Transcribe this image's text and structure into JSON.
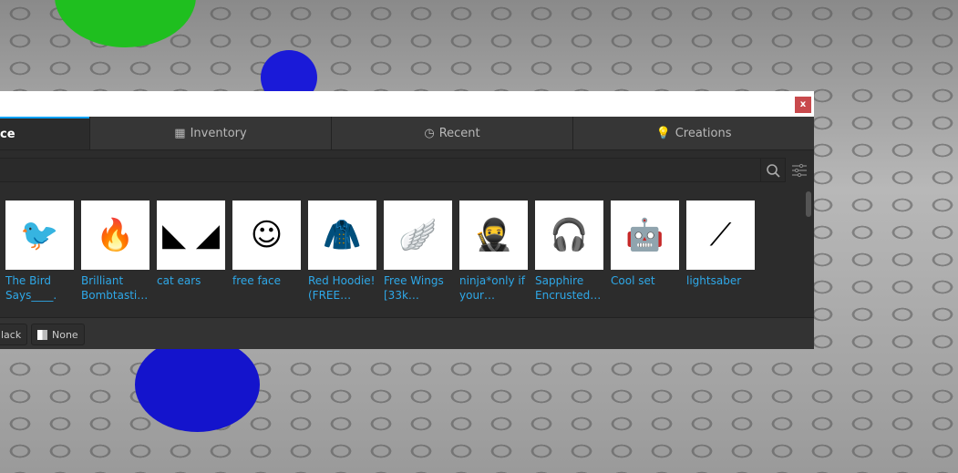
{
  "tabs": [
    {
      "label": "ce",
      "icon": "marketplace-icon"
    },
    {
      "label": "Inventory",
      "icon": "inventory-grid-icon"
    },
    {
      "label": "Recent",
      "icon": "clock-icon"
    },
    {
      "label": "Creations",
      "icon": "lightbulb-icon"
    }
  ],
  "close_label": "x",
  "items": [
    {
      "name": "The Bird\nSays____.",
      "glyph": "🐦"
    },
    {
      "name": "Brilliant\nBombtasti…",
      "glyph": "🔥"
    },
    {
      "name": "cat ears",
      "glyph": "◣ ◢"
    },
    {
      "name": "free face",
      "glyph": "☺"
    },
    {
      "name": "Red Hoodie!\n(FREE…",
      "glyph": "🧥"
    },
    {
      "name": "Free Wings\n[33k…",
      "glyph": "🪽"
    },
    {
      "name": "ninja*only if\nyour…",
      "glyph": "🥷"
    },
    {
      "name": "Sapphire\nEncrusted…",
      "glyph": "🎧"
    },
    {
      "name": "Cool set",
      "glyph": "🤖"
    },
    {
      "name": "lightsaber",
      "glyph": "⟋"
    }
  ],
  "bottom": {
    "black_label": "lack",
    "none_label": "None"
  }
}
